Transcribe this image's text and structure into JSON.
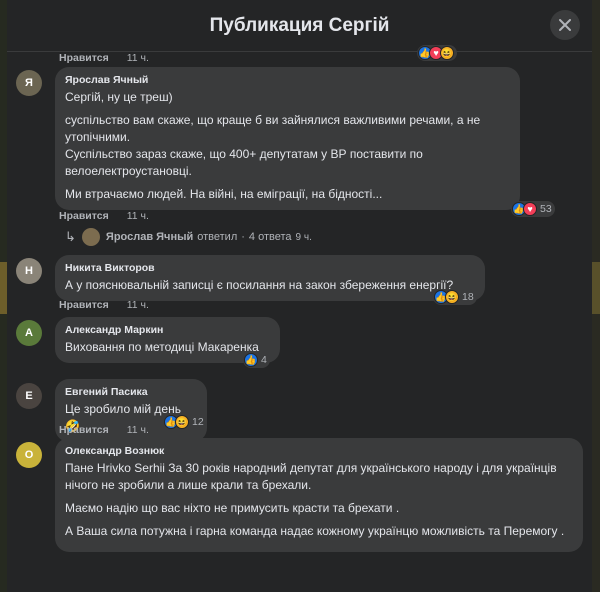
{
  "dialog": {
    "title": "Публикация Сергій",
    "close_icon": "close-icon"
  },
  "top_actions": {
    "like": "Нравится",
    "time": "11 ч."
  },
  "comments": [
    {
      "author": "Ярослав Ячный",
      "paragraphs": [
        "Сергій, ну це треш)",
        "суспільство вам скаже, що краще б ви зайнялися важливими речами, а не утопічними.\nСуспільство зараз скаже, що 400+ депутатам у ВР поставити по велоелектроустановці.",
        "Ми втрачаємо людей. На війні, на еміграції, на бідності..."
      ],
      "like": "Нравится",
      "time": "11 ч.",
      "reactions": [
        "like-icon",
        "love-icon"
      ],
      "count": "53"
    },
    {
      "author": "Никита Викторов",
      "paragraphs": [
        "А у пояснювальній записці є посилання на закон збереження енергії?"
      ],
      "like": "Нравится",
      "time": "11 ч.",
      "reactions": [
        "like-icon",
        "haha-icon"
      ],
      "count": "18"
    },
    {
      "author": "Александр Маркин",
      "paragraphs": [
        "Виховання по методиці Макаренка"
      ],
      "like": "Нравится",
      "time": "11 ч.",
      "reactions": [
        "like-icon"
      ],
      "count": "4"
    },
    {
      "author": "Евгений Пасика",
      "paragraphs": [
        "Це зробило мій день"
      ],
      "emoji": "🤣",
      "like": "Нравится",
      "time": "11 ч.",
      "reactions": [
        "like-icon",
        "haha-icon"
      ],
      "count": "12"
    },
    {
      "author": "Олександр Вознюк",
      "paragraphs": [
        "Пане Hrivko Serhii  За 30 років народний депутат для українського народу і для українців нічого не зробили а лише крали та брехали.",
        "Маємо надію що вас ніхто не примусить красти та брехати .",
        "А Ваша сила потужна і гарна команда  надає кожному українцю можливість та Перемогу ."
      ]
    }
  ],
  "reply_link": {
    "name": "Ярослав Ячный",
    "action": "ответил",
    "sep": "·",
    "count": "4 ответа",
    "time": "9 ч."
  },
  "colors": {
    "dialog_bg": "#242526",
    "bubble_bg": "#3a3b3c",
    "text": "#e4e6eb",
    "secondary": "#b0b3b8",
    "like_blue": "#1b74e4",
    "love_red": "#f33e58",
    "haha_yellow": "#f7b125"
  }
}
